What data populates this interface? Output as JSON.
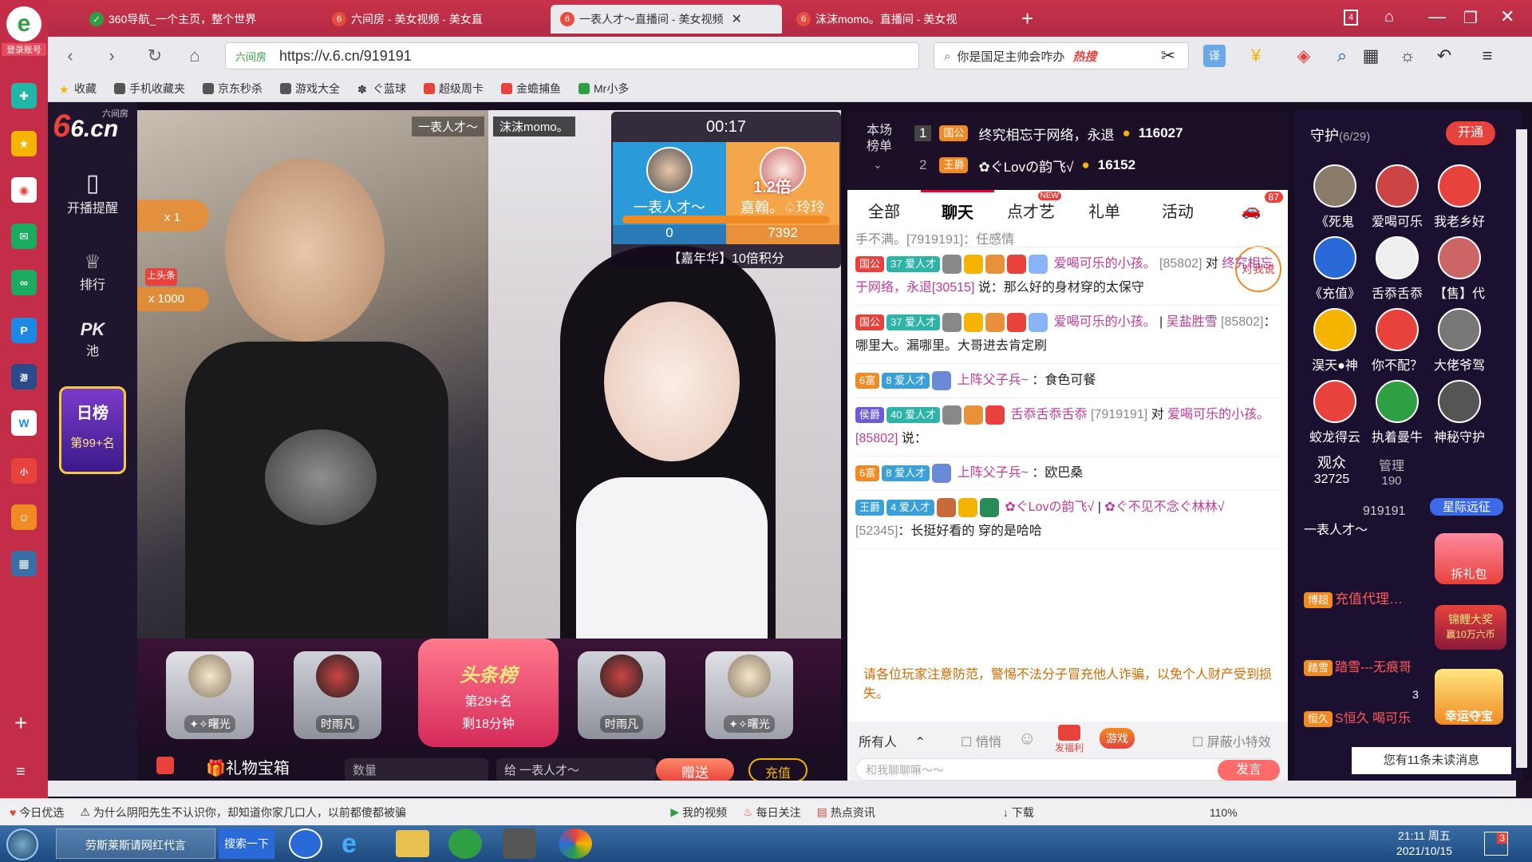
{
  "browser": {
    "login_label": "登录账号",
    "tabs": [
      {
        "label": "360导航_一个主页，整个世界"
      },
      {
        "label": "六间房 - 美女视频 - 美女直"
      },
      {
        "label": "一表人才～直播间 - 美女视频"
      },
      {
        "label": "沫沫momo。直播间 - 美女视"
      }
    ],
    "address": "https://v.6.cn/919191",
    "address_badge": "六间房",
    "search_placeholder": "你是国足主帅会咋办",
    "search_hot": "热搜",
    "bookmarks": [
      "收藏",
      "手机收藏夹",
      "京东秒杀",
      "游戏大全",
      "ぐ蓝球",
      "超级周卡",
      "金蟾捕鱼",
      "Mr小多"
    ],
    "tab_count": "4"
  },
  "site": {
    "logo_text": "6.cn",
    "logo_sub": "六间房",
    "sidebar": [
      {
        "label": "开播提醒"
      },
      {
        "label": "排行"
      },
      {
        "label": "池"
      }
    ],
    "pk_label": "PK",
    "daily_rank_title": "日榜",
    "daily_rank_value": "第99+名"
  },
  "video": {
    "left_name": "一表人才～",
    "right_name": "沫沫momo。",
    "gift_counts": [
      "x 1",
      "x 1000"
    ],
    "headline_badge": "上头条",
    "pk": {
      "timer": "00:17",
      "left_name": "一表人才～",
      "right_name": "嘉翰。♤玲玲",
      "multiplier": "1.2倍",
      "left_score": "0",
      "right_score": "7392",
      "footer": "【嘉年华】10倍积分"
    }
  },
  "seats": [
    {
      "name": "✦✧曙光"
    },
    {
      "name": "时雨凡"
    },
    {
      "name": "时雨凡"
    },
    {
      "name": "✦✧曙光"
    }
  ],
  "headline": {
    "title": "头条榜",
    "rank": "第29+名",
    "remain": "剩18分钟"
  },
  "giftbar": {
    "box_label": "礼物宝箱",
    "qty_placeholder": "数量",
    "to_label": "给 一表人才～",
    "send": "赠送",
    "recharge": "充值"
  },
  "rank": {
    "title": "本场榜单",
    "rows": [
      {
        "pos": "1",
        "badge": "国公",
        "name": "终究相忘于网络，永退",
        "score": "116027"
      },
      {
        "pos": "2",
        "badge": "王爵",
        "name": "✿ぐLovの韵飞√",
        "score": "16152"
      }
    ]
  },
  "chat": {
    "tabs": [
      {
        "label": "全部"
      },
      {
        "label": "聊天"
      },
      {
        "label": "点才艺"
      },
      {
        "label": "礼单"
      },
      {
        "label": "活动"
      }
    ],
    "new_badge": "NEW",
    "car_count": "87",
    "say_to_me": "对我说",
    "messages": [
      {
        "text": "手不满。[7919191]：任感情"
      },
      {
        "badge": "国公",
        "level": "37",
        "fan": "爱人才",
        "user": "爱喝可乐的小孩。",
        "uid": "[85802]",
        "verb": "对",
        "target": "终究相忘于网络，永退[30515]",
        "content": "说：那么好的身材穿的太保守"
      },
      {
        "badge": "国公",
        "level": "37",
        "fan": "爱人才",
        "user": "爱喝可乐的小孩。",
        "target": "吴盐胜雪",
        "uid": "[85802]",
        "content": "：哪里大。漏哪里。大哥进去肯定刷"
      },
      {
        "badge": "6富",
        "level": "8",
        "fan": "爱人才",
        "user": "上阵父子兵~",
        "content": "：食色可餐"
      },
      {
        "badge": "侯爵",
        "level": "40",
        "fan": "爱人才",
        "user": "舌忝舌忝舌忝",
        "uid": "[7919191]",
        "verb": "对",
        "target": "爱喝可乐的小孩。[85802]",
        "content": "说："
      },
      {
        "badge": "6富",
        "level": "8",
        "fan": "爱人才",
        "user": "上阵父子兵~",
        "content": "：欧巴桑"
      },
      {
        "badge": "王爵",
        "level": "4",
        "fan": "爱人才",
        "user": "✿ぐLovの韵飞√",
        "target": "✿ぐ不见不念ぐ林林√",
        "uid": "[52345]",
        "content": "：长挺好看的 穿的是哈哈"
      }
    ],
    "notice": "请各位玩家注意防范，警惕不法分子冒充他人诈骗，以免个人财产受到损失。",
    "input_target": "所有人",
    "whisper": "悄悄",
    "fuli": "发福利",
    "game": "游戏",
    "shield_fx": "屏蔽小特效",
    "input_placeholder": "和我聊聊嘛～～",
    "send": "发言"
  },
  "guard": {
    "title": "守护",
    "count": "(6/29)",
    "open": "开通",
    "members": [
      {
        "name": "《死鬼"
      },
      {
        "name": "爱喝可乐"
      },
      {
        "name": "我老乡好"
      },
      {
        "name": "《充值》"
      },
      {
        "name": "舌忝舌忝"
      },
      {
        "name": "【售】代"
      },
      {
        "name": "淏天●神"
      },
      {
        "name": "你不配？"
      },
      {
        "name": "大佬爷驾"
      },
      {
        "name": "蛟龙得云"
      },
      {
        "name": "执着曼牛"
      },
      {
        "name": "神秘守护"
      }
    ],
    "audience_label": "观众",
    "audience_count": "32725",
    "admin_label": "管理",
    "admin_count": "190",
    "expedition": "星际远征",
    "unpack": "拆礼包",
    "lucky": "幸运夺宝",
    "koi": "锦鲤大奖",
    "koi_sub": "赢10万六币",
    "viewers": [
      {
        "tag": "",
        "name": "一表人才～",
        "uid": "919191"
      },
      {
        "tag": "博超",
        "name": "充值代理…"
      },
      {
        "tag": "踏雪",
        "name": "踏雪---无痕哥"
      },
      {
        "tag": "恒久",
        "name": "S恒久"
      }
    ],
    "viewer_b": "3",
    "viewer_c": "喝可乐",
    "unread": "您有11条未读消息"
  },
  "statusbar": {
    "items": [
      "今日优选",
      "为什么阴阳先生不认识你，却知道你家几口人，以前都傻都被骗",
      "我的视频",
      "每日关注",
      "热点资讯",
      "下载",
      "110%"
    ]
  },
  "taskbar": {
    "items": [
      "劳斯莱斯请网红代言",
      "搜索一下"
    ],
    "time": "21:11 周五",
    "date": "2021/10/15",
    "notif": "3"
  },
  "colors": {
    "accent": "#c42d48",
    "chat_accent": "#e03",
    "orange": "#f08b23"
  }
}
